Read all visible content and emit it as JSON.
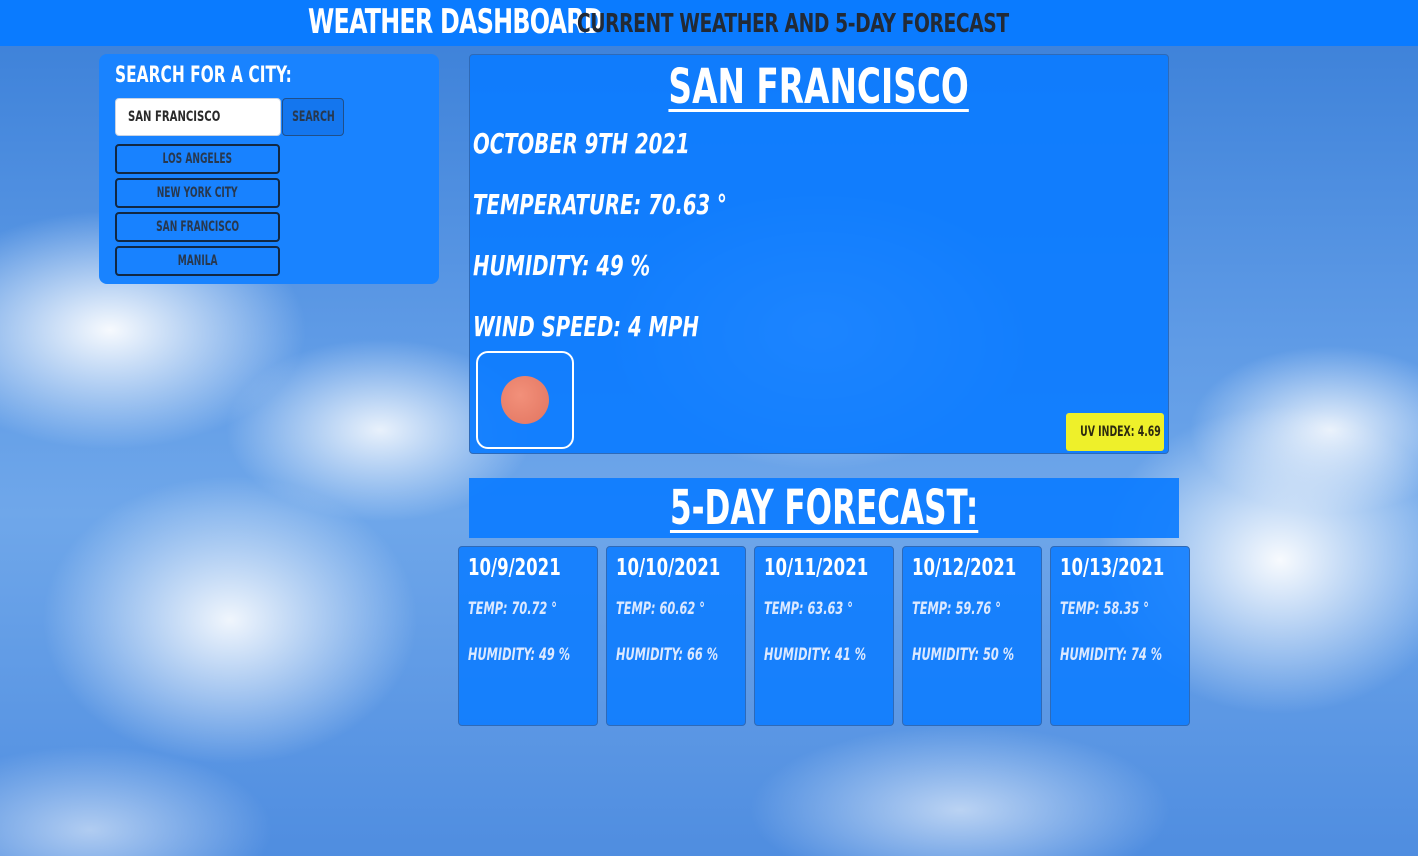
{
  "header": {
    "title": "Weather Dashboard",
    "subtitle": "Current weather and 5-day forecast"
  },
  "search": {
    "heading": "Search for a city:",
    "input_value": "San Francisco",
    "button_label": "Search"
  },
  "history": [
    {
      "label": "Los Angeles"
    },
    {
      "label": "New York City"
    },
    {
      "label": "San Francisco"
    },
    {
      "label": "Manila"
    }
  ],
  "current": {
    "city": "San Francisco",
    "date": "October 9th 2021",
    "temperature": "Temperature: 70.63 °",
    "humidity": "Humidity: 49 %",
    "wind": "Wind Speed: 4 MPH",
    "icon": "sun-icon",
    "uv_index": "UV Index: 4.69",
    "uv_color": "#eef02a"
  },
  "forecast": {
    "heading": "5-Day Forecast:",
    "days": [
      {
        "date": "10/9/2021",
        "temp": "Temp: 70.72 °",
        "humidity": "Humidity: 49 %"
      },
      {
        "date": "10/10/2021",
        "temp": "Temp: 60.62 °",
        "humidity": "Humidity: 66 %"
      },
      {
        "date": "10/11/2021",
        "temp": "Temp: 63.63 °",
        "humidity": "Humidity: 41 %"
      },
      {
        "date": "10/12/2021",
        "temp": "Temp: 59.76 °",
        "humidity": "Humidity: 50 %"
      },
      {
        "date": "10/13/2021",
        "temp": "Temp: 58.35 °",
        "humidity": "Humidity: 74 %"
      }
    ]
  },
  "colors": {
    "header_bg": "#0a7bff",
    "panel_bg": "#1983ff",
    "uv_badge": "#eef02a"
  }
}
